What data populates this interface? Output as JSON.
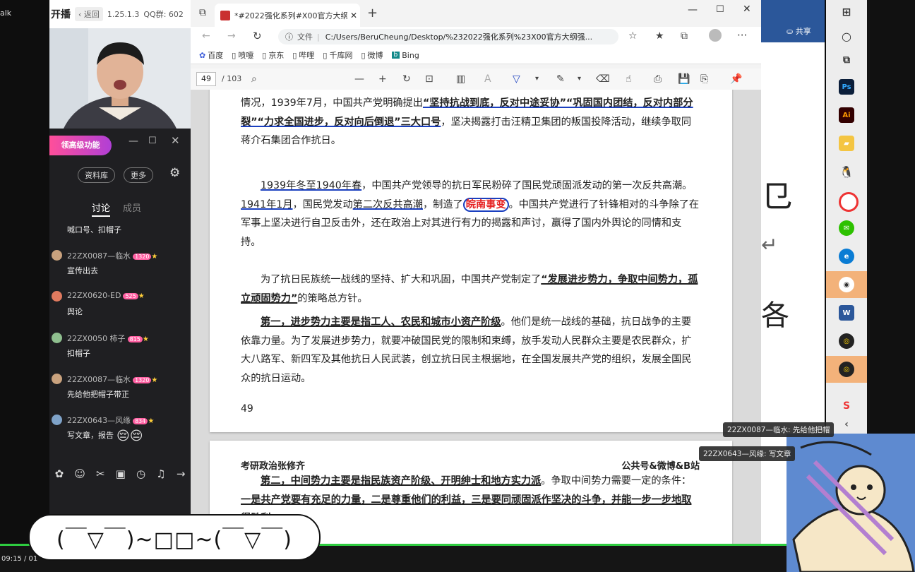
{
  "left_edge": {
    "label": "alk"
  },
  "live_app": {
    "title": "开播",
    "back_label": "返回",
    "version": "1.25.1.3",
    "qq_group": "QQ群: 602",
    "promo": "领高级功能",
    "buttons": [
      "资料库",
      "更多"
    ],
    "tabs": {
      "discussion": "讨论",
      "members": "成员"
    },
    "chat": [
      {
        "name": "",
        "text": "喊口号、扣帽子",
        "badge": ""
      },
      {
        "name": "22ZX0087—临水",
        "text": "宣传出去",
        "badge": "1320"
      },
      {
        "name": "22ZX0620-ED",
        "text": "舆论",
        "badge": "525"
      },
      {
        "name": "22ZX0050 柿子",
        "text": "扣帽子",
        "badge": "815"
      },
      {
        "name": "22ZX0087—临水",
        "text": "先给他把帽子带正",
        "badge": "1320"
      },
      {
        "name": "22ZX0643—风缘",
        "text": "写文章，报告",
        "badge": "834"
      }
    ]
  },
  "browser": {
    "tab_title": "*#2022强化系列#X00官方大纲强",
    "file_label": "文件",
    "url": "C:/Users/BeruCheung/Desktop/%232022强化系列%23X00官方大纲强...",
    "bookmarks": [
      "百度",
      "喷嚏",
      "京东",
      "哔哩",
      "千库网",
      "微博",
      "Bing"
    ],
    "pdf": {
      "page": "49",
      "total": "/ 103"
    }
  },
  "document": {
    "p1_pre": "情况，1939年7月，中国共产党明确提出",
    "p1_slogan": "“坚持抗战到底，反对中途妥协”“巩固国内团结，反对内部分裂”“力求全国进步，反对向后倒退”三大口号",
    "p1_post": "，坚决揭露打击汪精卫集团的叛国投降活动，继续争取同蒋介石集团合作抗日。",
    "p2_a": "1939年冬至1940年春",
    "p2_b": "，中国共产党领导的抗日军民粉碎了国民党顽固派发动的第一次反共高潮。",
    "p2_c": "1941年1月",
    "p2_d": "，国民党发动",
    "p2_e": "第二次反共高潮",
    "p2_f": "，制造了",
    "p2_red": "皖南事变",
    "p2_g": "。中国共产党进行了针锋相对的斗争除了在军事上坚决进行自卫反击外，还在政治上对其进行有力的揭露和声讨，赢得了国内外舆论的同情和支持。",
    "p3_pre": "为了抗日民族统一战线的坚持、扩大和巩固，中国共产党制定了",
    "p3_bold": "“发展进步势力，争取中间势力，孤立顽固势力”",
    "p3_post": "的策略总方针。",
    "p4_bold": "第一，进步势力主要是指工人、农民和城市小资产阶级",
    "p4_post": "。他们是统一战线的基础，抗日战争的主要依靠力量。为了发展进步势力，就要冲破国民党的限制和束缚，放手发动人民群众主要是农民群众，扩大八路军、新四军及其他抗日人民武装，创立抗日民主根据地，在全国发展共产党的组织，发展全国民众的抗日运动。",
    "page_number": "49",
    "header_left": "考研政治张修齐",
    "header_right": "公共号&微博&B站",
    "p5_bold": "第二，中间势力主要是指民族资产阶级、开明绅士和地方实力派",
    "p5_post": "。争取中间势力需要一定的条件：",
    "p5_u": "一是共产党要有充足的力量，二是尊重他们的利益，三是要同顽固派作坚决的斗争，并能一步一步地取得胜利",
    "p5_end": "。"
  },
  "word_panel": {
    "share": "共享"
  },
  "toasts": [
    "22ZX0087—临水: 先给他把帽",
    "22ZX0643—风缘: 写文章"
  ],
  "kaomoji": "(￣▽￣)~□□~(￣▽￣)",
  "time": "09:15 / 01",
  "colors": {
    "accent_red": "#e52020",
    "annotation_blue": "#1a3fbf",
    "chat_bg": "#1f1f22"
  }
}
